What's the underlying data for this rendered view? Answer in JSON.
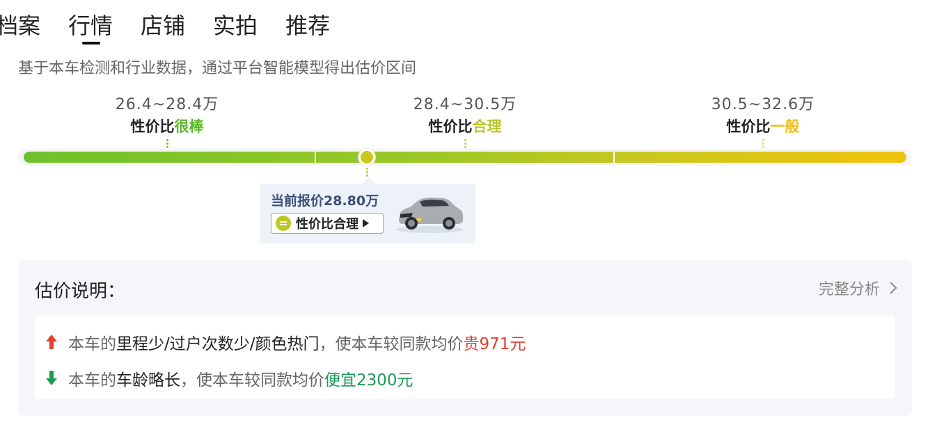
{
  "tabs": [
    "档案",
    "行情",
    "店铺",
    "实拍",
    "推荐"
  ],
  "active_tab": "行情",
  "subtitle": "基于本车检测和行业数据，通过平台智能模型得出估价区间",
  "ranges": [
    {
      "price": "26.4~28.4万",
      "label_prefix": "性价比",
      "label_highlight": "很棒",
      "color": "#5cb82a"
    },
    {
      "price": "28.4~30.5万",
      "label_prefix": "性价比",
      "label_highlight": "合理",
      "color": "#b9c81e"
    },
    {
      "price": "30.5~32.6万",
      "label_prefix": "性价比",
      "label_highlight": "一般",
      "color": "#efbf0c"
    }
  ],
  "bar_colors": {
    "start": "#6ec12b",
    "mid": "#c9c81e",
    "end": "#f2c30d"
  },
  "current": {
    "label": "当前报价28.80万",
    "rating": "性价比合理",
    "icon": "car-image"
  },
  "explain": {
    "title": "估价说明：",
    "more": "完整分析",
    "items": [
      {
        "icon": "arrow-up-icon",
        "prefix": "本车的",
        "factor": "里程少/过户次数少/颜色热门",
        "middle": "，使本车较同款均价",
        "effect": "贵971元",
        "color": "#e1412e"
      },
      {
        "icon": "arrow-down-icon",
        "prefix": "本车的",
        "factor": "车龄略长",
        "middle": "，使本车较同款均价",
        "effect": "便宜2300元",
        "color": "#1f9a55"
      }
    ]
  }
}
